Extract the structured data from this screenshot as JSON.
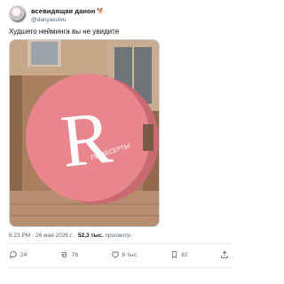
{
  "author": {
    "display_name": "всевидящая данон",
    "emoji": "🐕",
    "handle": "@danyasuwu"
  },
  "tweet": {
    "text": "Худшего нейминга вы не увидите"
  },
  "photo": {
    "sign_letter": "R",
    "sign_text": "ПВ ДЕСЕРТЫ",
    "colors": {
      "sign": "#e9838a",
      "letter": "#ffffff",
      "wall": "#b58a6a"
    }
  },
  "meta": {
    "time": "6:23 PM",
    "date": "26 мая 2026 г.",
    "separator": "·",
    "views": "52,3 тыс.",
    "views_label": "просмотр"
  },
  "actions": {
    "replies": "24",
    "retweets": "78",
    "likes": "6 тыс.",
    "bookmarks": "82"
  }
}
